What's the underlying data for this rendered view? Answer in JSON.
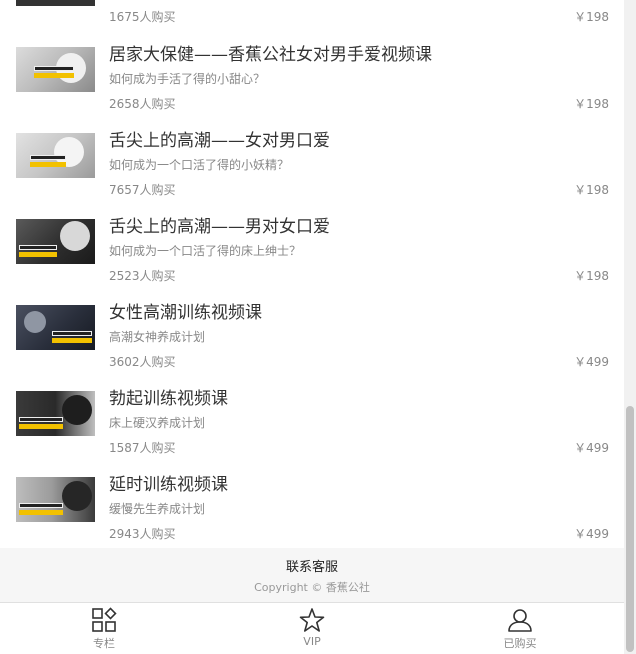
{
  "first_row": {
    "buyers": "1675人购买",
    "price": "￥198"
  },
  "courses": [
    {
      "title": "居家大保健——香蕉公社女对男手爱视频课",
      "subtitle": "如何成为手活了得的小甜心？",
      "buyers": "2658人购买",
      "price": "￥198"
    },
    {
      "title": "舌尖上的高潮——女对男口爱",
      "subtitle": "如何成为一个口活了得的小妖精？",
      "buyers": "7657人购买",
      "price": "￥198"
    },
    {
      "title": "舌尖上的高潮——男对女口爱",
      "subtitle": "如何成为一个口活了得的床上绅士？",
      "buyers": "2523人购买",
      "price": "￥198"
    },
    {
      "title": "女性高潮训练视频课",
      "subtitle": "高潮女神养成计划",
      "buyers": "3602人购买",
      "price": "￥499"
    },
    {
      "title": "勃起训练视频课",
      "subtitle": "床上硬汉养成计划",
      "buyers": "1587人购买",
      "price": "￥499"
    },
    {
      "title": "延时训练视频课",
      "subtitle": "缓慢先生养成计划",
      "buyers": "2943人购买",
      "price": "￥499"
    }
  ],
  "footer": {
    "contact": "联系客服",
    "copyright": "Copyright © 香蕉公社"
  },
  "tabbar": {
    "items": [
      {
        "label": "专栏",
        "icon": "columns-icon"
      },
      {
        "label": "VIP",
        "icon": "star-icon"
      },
      {
        "label": "已购买",
        "icon": "user-icon"
      }
    ]
  },
  "colors": {
    "accent_band": "#f2c100",
    "muted_text": "#888888",
    "footer_bg": "#f6f6f6"
  }
}
